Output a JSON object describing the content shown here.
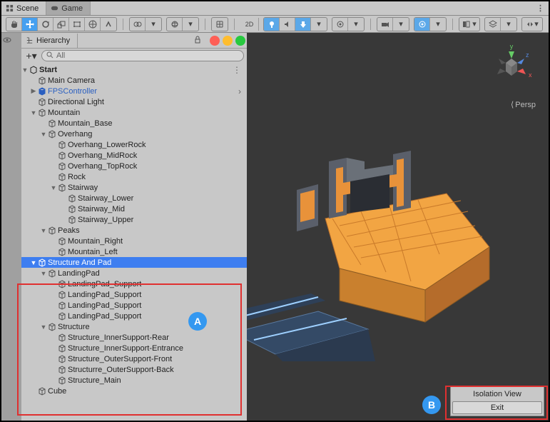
{
  "tabs": {
    "scene": "Scene",
    "game": "Game"
  },
  "hierarchy": {
    "title": "Hierarchy",
    "search_placeholder": "All",
    "root": "Start",
    "items": {
      "main_camera": "Main Camera",
      "fps": "FPSController",
      "dir_light": "Directional Light",
      "mountain": "Mountain",
      "mountain_base": "Mountain_Base",
      "overhang": "Overhang",
      "overhang_lower": "Overhang_LowerRock",
      "overhang_mid": "Overhang_MidRock",
      "overhang_top": "Overhang_TopRock",
      "rock": "Rock",
      "stairway": "Stairway",
      "stair_lower": "Stairway_Lower",
      "stair_mid": "Stairway_Mid",
      "stair_upper": "Stairway_Upper",
      "peaks": "Peaks",
      "mt_right": "Mountain_Right",
      "mt_left": "Mountain_Left",
      "structure_pad": "Structure And Pad",
      "landing": "LandingPad",
      "lp_support": "LandingPad_Support",
      "structure": "Structure",
      "s_inner_rear": "Structure_InnerSupport-Rear",
      "s_inner_ent": "Structure_InnerSupport-Entrance",
      "s_outer_front": "Structure_OuterSupport-Front",
      "s_outer_back": "Structurre_OuterSupport-Back",
      "s_main": "Structure_Main",
      "cube": "Cube"
    }
  },
  "viewport": {
    "persp_label": "Persp",
    "axes": {
      "x": "x",
      "y": "y",
      "z": "z"
    },
    "isolation_label": "Isolation View",
    "exit_label": "Exit"
  },
  "callouts": {
    "a": "A",
    "b": "B"
  }
}
